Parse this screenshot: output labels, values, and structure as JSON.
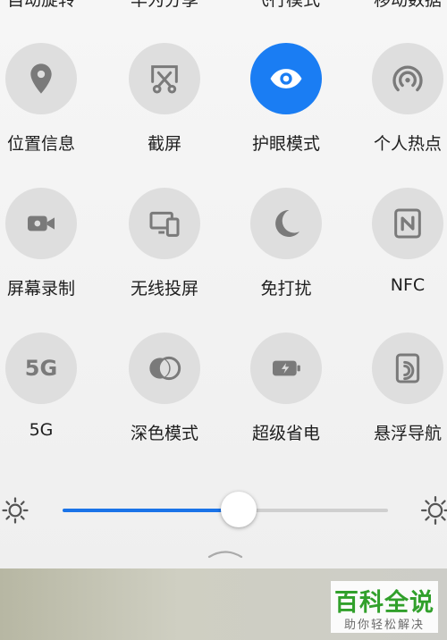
{
  "top_row_labels": [
    "自动旋转",
    "华为分享",
    "飞行模式",
    "移动数据"
  ],
  "tiles": [
    {
      "label": "位置信息",
      "icon": "location-pin-icon",
      "active": false
    },
    {
      "label": "截屏",
      "icon": "screenshot-scissors-icon",
      "active": false
    },
    {
      "label": "护眼模式",
      "icon": "eye-icon",
      "active": true
    },
    {
      "label": "个人热点",
      "icon": "hotspot-icon",
      "active": false
    },
    {
      "label": "屏幕录制",
      "icon": "video-camera-icon",
      "active": false
    },
    {
      "label": "无线投屏",
      "icon": "wireless-projection-icon",
      "active": false
    },
    {
      "label": "免打扰",
      "icon": "crescent-moon-icon",
      "active": false
    },
    {
      "label": "NFC",
      "icon": "nfc-icon",
      "active": false
    },
    {
      "label": "5G",
      "icon": "5g-icon",
      "icon_text": "5G",
      "active": false
    },
    {
      "label": "深色模式",
      "icon": "dark-mode-icon",
      "active": false
    },
    {
      "label": "超级省电",
      "icon": "battery-bolt-icon",
      "active": false
    },
    {
      "label": "悬浮导航",
      "icon": "floating-navigation-icon",
      "active": false
    }
  ],
  "brightness": {
    "level_percent": 54
  },
  "colors": {
    "accent": "#1a7df3",
    "tile_bg": "#dedede",
    "icon_gray": "#7a7a7a",
    "slider_fill": "#1a73e8"
  },
  "watermark": {
    "title": "百科全说",
    "subtitle": "助你轻松解决"
  }
}
